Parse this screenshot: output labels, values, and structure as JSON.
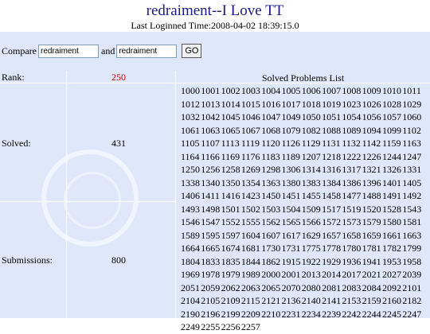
{
  "header": {
    "title": "redraiment--I Love TT",
    "last_login": "Last Loginned Time:2008-04-02 18:39:15.0"
  },
  "compare": {
    "label": "Compare",
    "user1": "redraiment",
    "and_label": "and",
    "user2": "redraiment",
    "go_label": "GO"
  },
  "stats": {
    "rank_label": "Rank:",
    "rank_value": "250",
    "solved_label": "Solved:",
    "solved_value": "431",
    "submissions_label": "Submissions:",
    "submissions_value": "800"
  },
  "solved_list": {
    "title": "Solved Problems List",
    "problems": [
      "1000",
      "1001",
      "1002",
      "1003",
      "1004",
      "1005",
      "1006",
      "1007",
      "1008",
      "1009",
      "1010",
      "1011",
      "1012",
      "1013",
      "1014",
      "1015",
      "1016",
      "1017",
      "1018",
      "1019",
      "1023",
      "1026",
      "1028",
      "1029",
      "1032",
      "1042",
      "1045",
      "1046",
      "1047",
      "1049",
      "1050",
      "1051",
      "1054",
      "1056",
      "1057",
      "1060",
      "1061",
      "1063",
      "1065",
      "1067",
      "1068",
      "1079",
      "1082",
      "1088",
      "1089",
      "1094",
      "1099",
      "1102",
      "1105",
      "1107",
      "1113",
      "1119",
      "1120",
      "1126",
      "1129",
      "1131",
      "1132",
      "1142",
      "1159",
      "1163",
      "1164",
      "1166",
      "1169",
      "1176",
      "1183",
      "1189",
      "1207",
      "1218",
      "1222",
      "1226",
      "1244",
      "1247",
      "1250",
      "1256",
      "1258",
      "1269",
      "1298",
      "1306",
      "1314",
      "1316",
      "1317",
      "1321",
      "1326",
      "1331",
      "1338",
      "1340",
      "1350",
      "1354",
      "1363",
      "1380",
      "1383",
      "1384",
      "1386",
      "1396",
      "1401",
      "1405",
      "1406",
      "1411",
      "1416",
      "1423",
      "1450",
      "1451",
      "1455",
      "1458",
      "1477",
      "1488",
      "1491",
      "1492",
      "1493",
      "1498",
      "1501",
      "1502",
      "1503",
      "1504",
      "1509",
      "1517",
      "1519",
      "1520",
      "1528",
      "1543",
      "1546",
      "1547",
      "1552",
      "1555",
      "1562",
      "1565",
      "1566",
      "1572",
      "1573",
      "1579",
      "1580",
      "1581",
      "1589",
      "1595",
      "1597",
      "1604",
      "1607",
      "1617",
      "1629",
      "1657",
      "1658",
      "1659",
      "1661",
      "1663",
      "1664",
      "1665",
      "1674",
      "1681",
      "1730",
      "1731",
      "1775",
      "1778",
      "1780",
      "1781",
      "1782",
      "1799",
      "1804",
      "1833",
      "1835",
      "1844",
      "1862",
      "1915",
      "1922",
      "1929",
      "1936",
      "1941",
      "1953",
      "1958",
      "1969",
      "1978",
      "1979",
      "1989",
      "2000",
      "2001",
      "2013",
      "2014",
      "2017",
      "2021",
      "2027",
      "2039",
      "2051",
      "2059",
      "2062",
      "2063",
      "2065",
      "2070",
      "2080",
      "2081",
      "2083",
      "2084",
      "2092",
      "2101",
      "2104",
      "2105",
      "2109",
      "2115",
      "2121",
      "2136",
      "2140",
      "2141",
      "2153",
      "2159",
      "2160",
      "2182",
      "2190",
      "2196",
      "2199",
      "2209",
      "2210",
      "2231",
      "2234",
      "2239",
      "2242",
      "2244",
      "2245",
      "2247",
      "2249",
      "2255",
      "2256",
      "2257"
    ]
  },
  "colors": {
    "title": "#1a1a8c",
    "rank_value": "#cc0000",
    "table_bg": "#dfe8fb"
  }
}
